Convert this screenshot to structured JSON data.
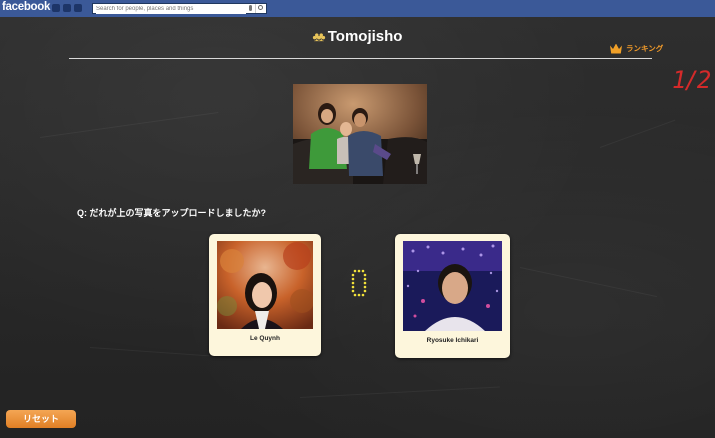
{
  "fb_bar": {
    "logo": "facebook",
    "search_placeholder": "Search for people, places and things"
  },
  "header": {
    "title": "Tomojisho",
    "logo_icon": "people-pair-icon",
    "ranking_label": "ランキング",
    "ranking_icon": "crown-icon",
    "progress": "1/2"
  },
  "quiz": {
    "question": "Q: だれが上の写真をアップロードしましたか?",
    "timer_value": "0",
    "choices": [
      {
        "name": "Le Quynh"
      },
      {
        "name": "Ryosuke Ichikari"
      }
    ]
  },
  "footer": {
    "reset_label": "リセット"
  },
  "colors": {
    "facebook_blue": "#3b5998",
    "board": "#2b2b2b",
    "accent_orange": "#f09a2a",
    "counter_red": "#d42a2a",
    "timer_yellow": "#f2e23a",
    "card_bg": "#fdf6dc"
  }
}
